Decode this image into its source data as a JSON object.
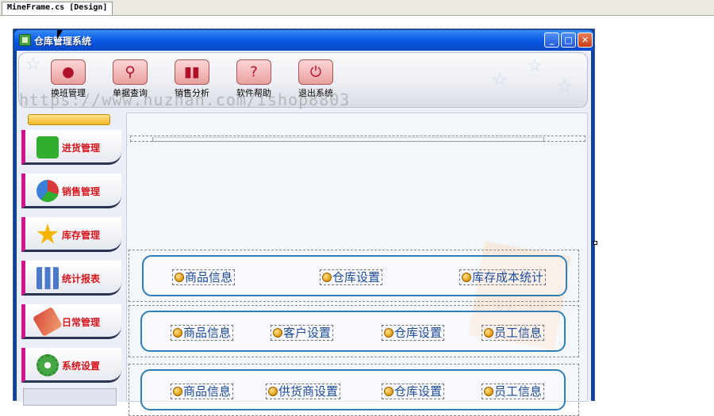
{
  "ide": {
    "document_tab": "MineFrame.cs [Design]"
  },
  "window": {
    "title": "仓库管理系统",
    "minimize_glyph": "_",
    "maximize_glyph": "□",
    "close_glyph": "✕"
  },
  "toolbar": {
    "buttons": [
      {
        "label": "换班管理",
        "icon": "users-icon"
      },
      {
        "label": "单据查询",
        "icon": "magnifier-icon"
      },
      {
        "label": "销售分析",
        "icon": "bar-chart-icon"
      },
      {
        "label": "软件帮助",
        "icon": "help-icon"
      },
      {
        "label": "退出系统",
        "icon": "power-icon"
      }
    ]
  },
  "watermark": "https://www.huzhan.com/ishop8803",
  "nav": {
    "items": [
      {
        "label": "进货管理",
        "icon": "plus-icon",
        "color": "#2fae2f"
      },
      {
        "label": "销售管理",
        "icon": "pie-chart-icon",
        "color": "#3a7fd8"
      },
      {
        "label": "库存管理",
        "icon": "star-icon",
        "color": "#f5b400"
      },
      {
        "label": "统计报表",
        "icon": "bars-icon",
        "color": "#4b78c8"
      },
      {
        "label": "日常管理",
        "icon": "tools-icon",
        "color": "#d8483a"
      },
      {
        "label": "系统设置",
        "icon": "gear-icon",
        "color": "#45a845"
      }
    ]
  },
  "groups": [
    {
      "links": [
        "商品信息",
        "仓库设置",
        "库存成本统计"
      ]
    },
    {
      "links": [
        "商品信息",
        "客户设置",
        "仓库设置",
        "员工信息"
      ]
    },
    {
      "links": [
        "商品信息",
        "供货商设置",
        "仓库设置",
        "员工信息"
      ]
    }
  ]
}
